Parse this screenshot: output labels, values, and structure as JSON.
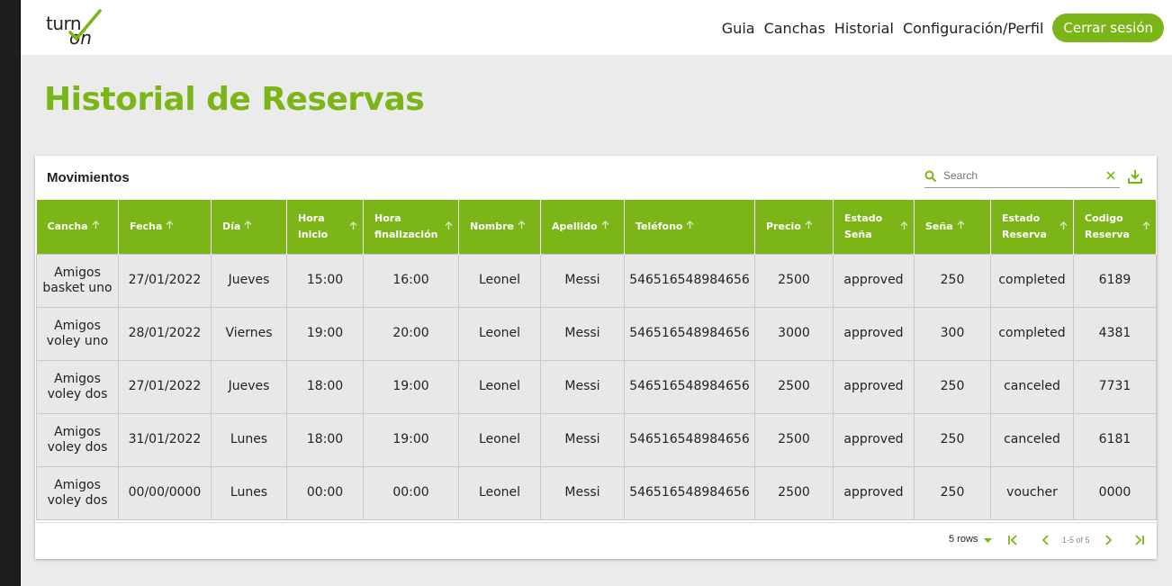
{
  "brand": {
    "logo_top": "turn",
    "logo_bottom": "on",
    "accent": "#7cb518"
  },
  "nav": {
    "items": [
      {
        "label": "Guia"
      },
      {
        "label": "Canchas"
      },
      {
        "label": "Historial"
      },
      {
        "label": "Configuración/Perfil"
      }
    ],
    "logout_label": "Cerrar sesión"
  },
  "page": {
    "title": "Historial de Reservas"
  },
  "table_card": {
    "title": "Movimientos",
    "search_placeholder": "Search",
    "columns": [
      {
        "l1": "Cancha",
        "l2": ""
      },
      {
        "l1": "Fecha",
        "l2": ""
      },
      {
        "l1": "Día",
        "l2": ""
      },
      {
        "l1": "Hora",
        "l2": "inicio"
      },
      {
        "l1": "Hora",
        "l2": "finalización"
      },
      {
        "l1": "Nombre",
        "l2": ""
      },
      {
        "l1": "Apellido",
        "l2": ""
      },
      {
        "l1": "Teléfono",
        "l2": ""
      },
      {
        "l1": "Precio",
        "l2": ""
      },
      {
        "l1": "Estado",
        "l2": "Seña"
      },
      {
        "l1": "Seña",
        "l2": ""
      },
      {
        "l1": "Estado",
        "l2": "Reserva"
      },
      {
        "l1": "Codigo",
        "l2": "Reserva"
      }
    ],
    "rows": [
      {
        "cancha_l1": "Amigos",
        "cancha_l2": "basket uno",
        "fecha": "27/01/2022",
        "dia": "Jueves",
        "inicio": "15:00",
        "fin": "16:00",
        "nombre": "Leonel",
        "apellido": "Messi",
        "telefono": "546516548984656",
        "precio": "2500",
        "estado_sena": "approved",
        "sena": "250",
        "estado_reserva": "completed",
        "codigo": "6189"
      },
      {
        "cancha_l1": "Amigos",
        "cancha_l2": "voley uno",
        "fecha": "28/01/2022",
        "dia": "Viernes",
        "inicio": "19:00",
        "fin": "20:00",
        "nombre": "Leonel",
        "apellido": "Messi",
        "telefono": "546516548984656",
        "precio": "3000",
        "estado_sena": "approved",
        "sena": "300",
        "estado_reserva": "completed",
        "codigo": "4381"
      },
      {
        "cancha_l1": "Amigos",
        "cancha_l2": "voley dos",
        "fecha": "27/01/2022",
        "dia": "Jueves",
        "inicio": "18:00",
        "fin": "19:00",
        "nombre": "Leonel",
        "apellido": "Messi",
        "telefono": "546516548984656",
        "precio": "2500",
        "estado_sena": "approved",
        "sena": "250",
        "estado_reserva": "canceled",
        "codigo": "7731"
      },
      {
        "cancha_l1": "Amigos",
        "cancha_l2": "voley dos",
        "fecha": "31/01/2022",
        "dia": "Lunes",
        "inicio": "18:00",
        "fin": "19:00",
        "nombre": "Leonel",
        "apellido": "Messi",
        "telefono": "546516548984656",
        "precio": "2500",
        "estado_sena": "approved",
        "sena": "250",
        "estado_reserva": "canceled",
        "codigo": "6181"
      },
      {
        "cancha_l1": "Amigos",
        "cancha_l2": "voley dos",
        "fecha": "00/00/0000",
        "dia": "Lunes",
        "inicio": "00:00",
        "fin": "00:00",
        "nombre": "Leonel",
        "apellido": "Messi",
        "telefono": "546516548984656",
        "precio": "2500",
        "estado_sena": "approved",
        "sena": "250",
        "estado_reserva": "voucher",
        "codigo": "0000"
      }
    ],
    "pagination": {
      "rows_label": "5 rows",
      "info": "1-5 of 5"
    }
  },
  "icons": [
    "search-icon",
    "clear-icon",
    "download-icon",
    "sort-arrow-icon",
    "first-page-icon",
    "prev-page-icon",
    "next-page-icon",
    "last-page-icon",
    "caret-down-icon"
  ]
}
